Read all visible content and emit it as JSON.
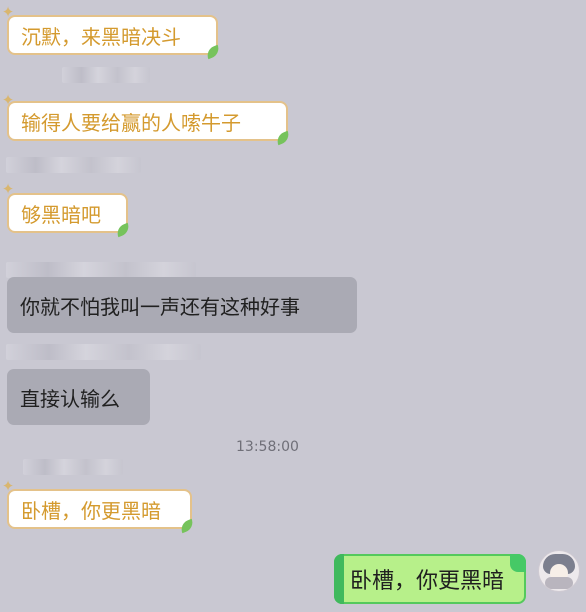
{
  "messages": [
    {
      "id": "m1",
      "type": "incoming_gold",
      "text": "沉默，来黑暗决斗"
    },
    {
      "id": "m2",
      "type": "incoming_gold",
      "text": "输得人要给赢的人嗦牛子"
    },
    {
      "id": "m3",
      "type": "incoming_gold",
      "text": "够黑暗吧"
    },
    {
      "id": "m4",
      "type": "incoming_gray",
      "text": "你就不怕我叫一声还有这种好事"
    },
    {
      "id": "m5",
      "type": "incoming_gray",
      "text": "直接认输么"
    },
    {
      "id": "m6",
      "type": "incoming_gold",
      "text": "卧槽，你更黑暗"
    },
    {
      "id": "m7",
      "type": "outgoing_green",
      "text": "卧槽，你更黑暗"
    }
  ],
  "timestamp": "13:58:00",
  "colors": {
    "background": "#c9c8d2",
    "gold_text": "#d49a2e",
    "gold_border": "#e4c28a",
    "gray_bubble": "#aaaab4",
    "green_bubble": "#b7f08a",
    "green_border": "#54c95c"
  },
  "icons": {
    "incoming_sticker": "sparkle-icon",
    "bubble_decoration": "leaf-icon",
    "avatar": "anime-avatar"
  }
}
